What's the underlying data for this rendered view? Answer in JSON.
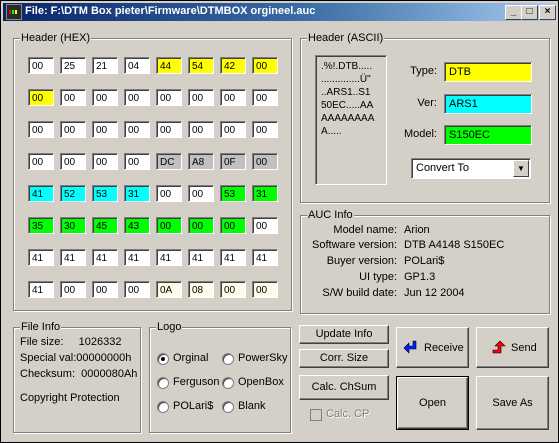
{
  "window": {
    "title": "File: F:\\DTM Box pieter\\Firmware\\DTMBOX orgineel.auc",
    "minimize": "_",
    "maximize": "□",
    "close": "×"
  },
  "header_hex": {
    "label": "Header (HEX)",
    "rows": [
      [
        "00",
        "25",
        "21",
        "04",
        "44",
        "54",
        "42",
        "00"
      ],
      [
        "00",
        "00",
        "00",
        "00",
        "00",
        "00",
        "00",
        "00"
      ],
      [
        "00",
        "00",
        "00",
        "00",
        "00",
        "00",
        "00",
        "00"
      ],
      [
        "00",
        "00",
        "00",
        "00",
        "DC",
        "A8",
        "0F",
        "00"
      ],
      [
        "41",
        "52",
        "53",
        "31",
        "00",
        "00",
        "53",
        "31"
      ],
      [
        "35",
        "30",
        "45",
        "43",
        "00",
        "00",
        "00",
        "00"
      ],
      [
        "41",
        "41",
        "41",
        "41",
        "41",
        "41",
        "41",
        "41"
      ],
      [
        "41",
        "00",
        "00",
        "00",
        "0A",
        "08",
        "00",
        "00"
      ]
    ],
    "colors": {
      "yellow": "#ffff00",
      "cyan": "#00ffff",
      "green": "#00ff00",
      "gray": "#c0c0c0",
      "white": "#ffffff",
      "cream": "#fffbe8"
    }
  },
  "header_ascii": {
    "label": "Header (ASCII)",
    "dump": ".%!.DTB.....\n..............Ü\"\n..ARS1..S1\n50EC.....AA\nAAAAAAAA\nA.....",
    "type_label": "Type:",
    "type_value": "DTB",
    "ver_label": "Ver:",
    "ver_value": "ARS1",
    "model_label": "Model:",
    "model_value": "S150EC",
    "convert_selected": "Convert To"
  },
  "auc_info": {
    "label": "AUC Info",
    "rows": [
      {
        "key": "Model name:",
        "value": "Arion"
      },
      {
        "key": "Software version:",
        "value": "DTB A4148 S150EC"
      },
      {
        "key": "Buyer version:",
        "value": "POLari$"
      },
      {
        "key": "UI type:",
        "value": "GP1.3"
      },
      {
        "key": "S/W build date:",
        "value": "Jun 12 2004"
      }
    ]
  },
  "file_info": {
    "label": "File Info",
    "size": "File size:     1026332",
    "special": "Special val:00000000h",
    "checksum": "Checksum:  0000080Ah",
    "protection": "Copyright Protection"
  },
  "logo": {
    "label": "Logo",
    "options": {
      "orginal": "Orginal",
      "powersky": "PowerSky",
      "ferguson": "Ferguson",
      "openbox": "OpenBox",
      "polaris": "POLari$",
      "blank": "Blank"
    },
    "selected": "Orginal"
  },
  "buttons": {
    "update_info": "Update Info",
    "corr_size": "Corr. Size",
    "calc_chsum": "Calc. ChSum",
    "calc_cp": "Calc. CP",
    "receive": "Receive",
    "send": "Send",
    "open": "Open",
    "save_as": "Save As"
  }
}
